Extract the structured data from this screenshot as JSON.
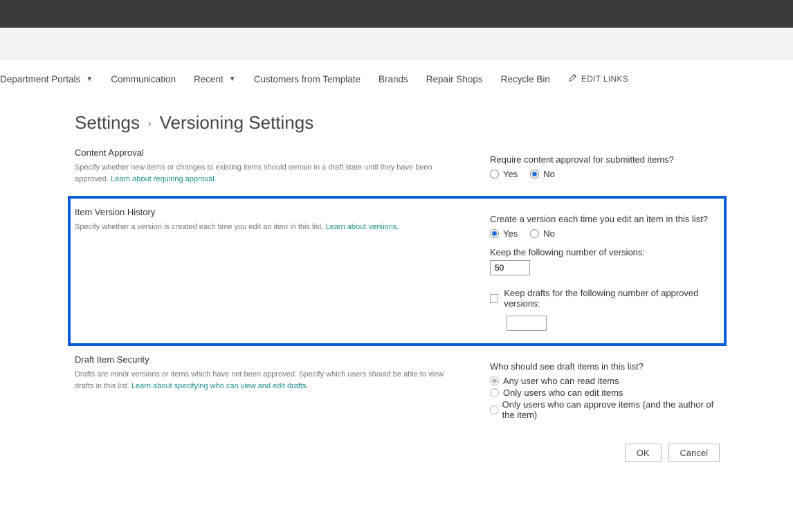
{
  "nav": {
    "items": [
      {
        "label": "Department Portals",
        "hasDropdown": true
      },
      {
        "label": "Communication",
        "hasDropdown": false
      },
      {
        "label": "Recent",
        "hasDropdown": true
      },
      {
        "label": "Customers from Template",
        "hasDropdown": false
      },
      {
        "label": "Brands",
        "hasDropdown": false
      },
      {
        "label": "Repair Shops",
        "hasDropdown": false
      },
      {
        "label": "Recycle Bin",
        "hasDropdown": false
      }
    ],
    "edit_links_label": "EDIT LINKS"
  },
  "breadcrumb": {
    "root": "Settings",
    "current": "Versioning Settings"
  },
  "sections": {
    "approval": {
      "title": "Content Approval",
      "desc": "Specify whether new items or changes to existing items should remain in a draft state until they have been approved.  ",
      "link": "Learn about requiring approval.",
      "question": "Require content approval for submitted items?",
      "yes": "Yes",
      "no": "No",
      "selected": "no"
    },
    "versioning": {
      "title": "Item Version History",
      "desc": "Specify whether a version is created each time you edit an item in this list.  ",
      "link": "Learn about versions.",
      "question": "Create a version each time you edit an item in this list?",
      "yes": "Yes",
      "no": "No",
      "selected": "yes",
      "keep_versions_label": "Keep the following number of versions:",
      "keep_versions_value": "50",
      "keep_drafts_label": "Keep drafts for the following number of approved versions:",
      "keep_drafts_value": "",
      "keep_drafts_checked": false
    },
    "draft_security": {
      "title": "Draft Item Security",
      "desc": "Drafts are minor versions or items which have not been approved. Specify which users should be able to view drafts in this list.  ",
      "link": "Learn about specifying who can view and edit drafts.",
      "question": "Who should see draft items in this list?",
      "opt1": "Any user who can read items",
      "opt2": "Only users who can edit items",
      "opt3": "Only users who can approve items (and the author of the item)",
      "selected": 0,
      "disabled": true
    }
  },
  "buttons": {
    "ok": "OK",
    "cancel": "Cancel"
  }
}
